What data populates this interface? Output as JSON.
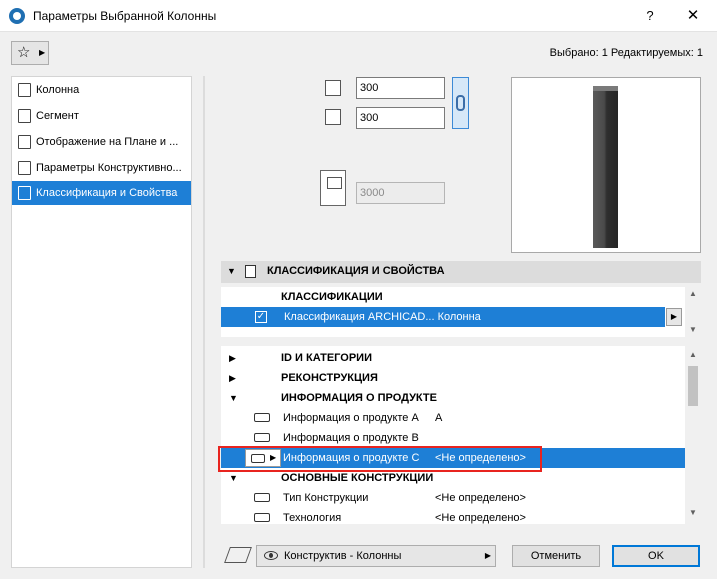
{
  "window": {
    "title": "Параметры Выбранной Колонны",
    "help": "?",
    "close": "✕"
  },
  "toolbar": {
    "favorites_icon": "☆",
    "favorites_arrow": "▶",
    "selected_info": "Выбрано: 1 Редактируемых: 1"
  },
  "sidebar": {
    "items": [
      {
        "label": "Колонна",
        "icon": "column-icon",
        "selected": false
      },
      {
        "label": "Сегмент",
        "icon": "segment-icon",
        "selected": false
      },
      {
        "label": "Отображение на Плане и ...",
        "icon": "plan-display-icon",
        "selected": false
      },
      {
        "label": "Параметры Конструктивно...",
        "icon": "structural-params-icon",
        "selected": false
      },
      {
        "label": "Классификация и Свойства",
        "icon": "classification-icon",
        "selected": true
      }
    ]
  },
  "dimensions": {
    "width": "300",
    "depth": "300",
    "height": "3000"
  },
  "classification_section": {
    "title": "КЛАССИФИКАЦИЯ И СВОЙСТВА",
    "subheader": "КЛАССИФИКАЦИИ",
    "row_label": "Классификация ARCHICAD... Колонна",
    "checked": true
  },
  "properties": {
    "groups": [
      {
        "label": "ID И КАТЕГОРИИ"
      },
      {
        "label": "РЕКОНСТРУКЦИЯ"
      },
      {
        "label": "ИНФОРМАЦИЯ О ПРОДУКТЕ"
      },
      {
        "label": "ОСНОВНЫЕ КОНСТРУКЦИИ"
      }
    ],
    "items": [
      {
        "name": "Информация о продукте А",
        "value": "А"
      },
      {
        "name": "Информация о продукте В",
        "value": ""
      },
      {
        "name": "Информация о продукте С",
        "value": "<Не определено>"
      },
      {
        "name": "Тип Конструкции",
        "value": "<Не определено>"
      },
      {
        "name": "Технология",
        "value": "<Не определено>"
      }
    ]
  },
  "footer": {
    "layer": "Конструктив - Колонны",
    "cancel": "Отменить",
    "ok": "OK"
  },
  "colors": {
    "selection": "#1e7fd6",
    "highlight_box": "#e8241f",
    "primary_border": "#0078d7"
  }
}
